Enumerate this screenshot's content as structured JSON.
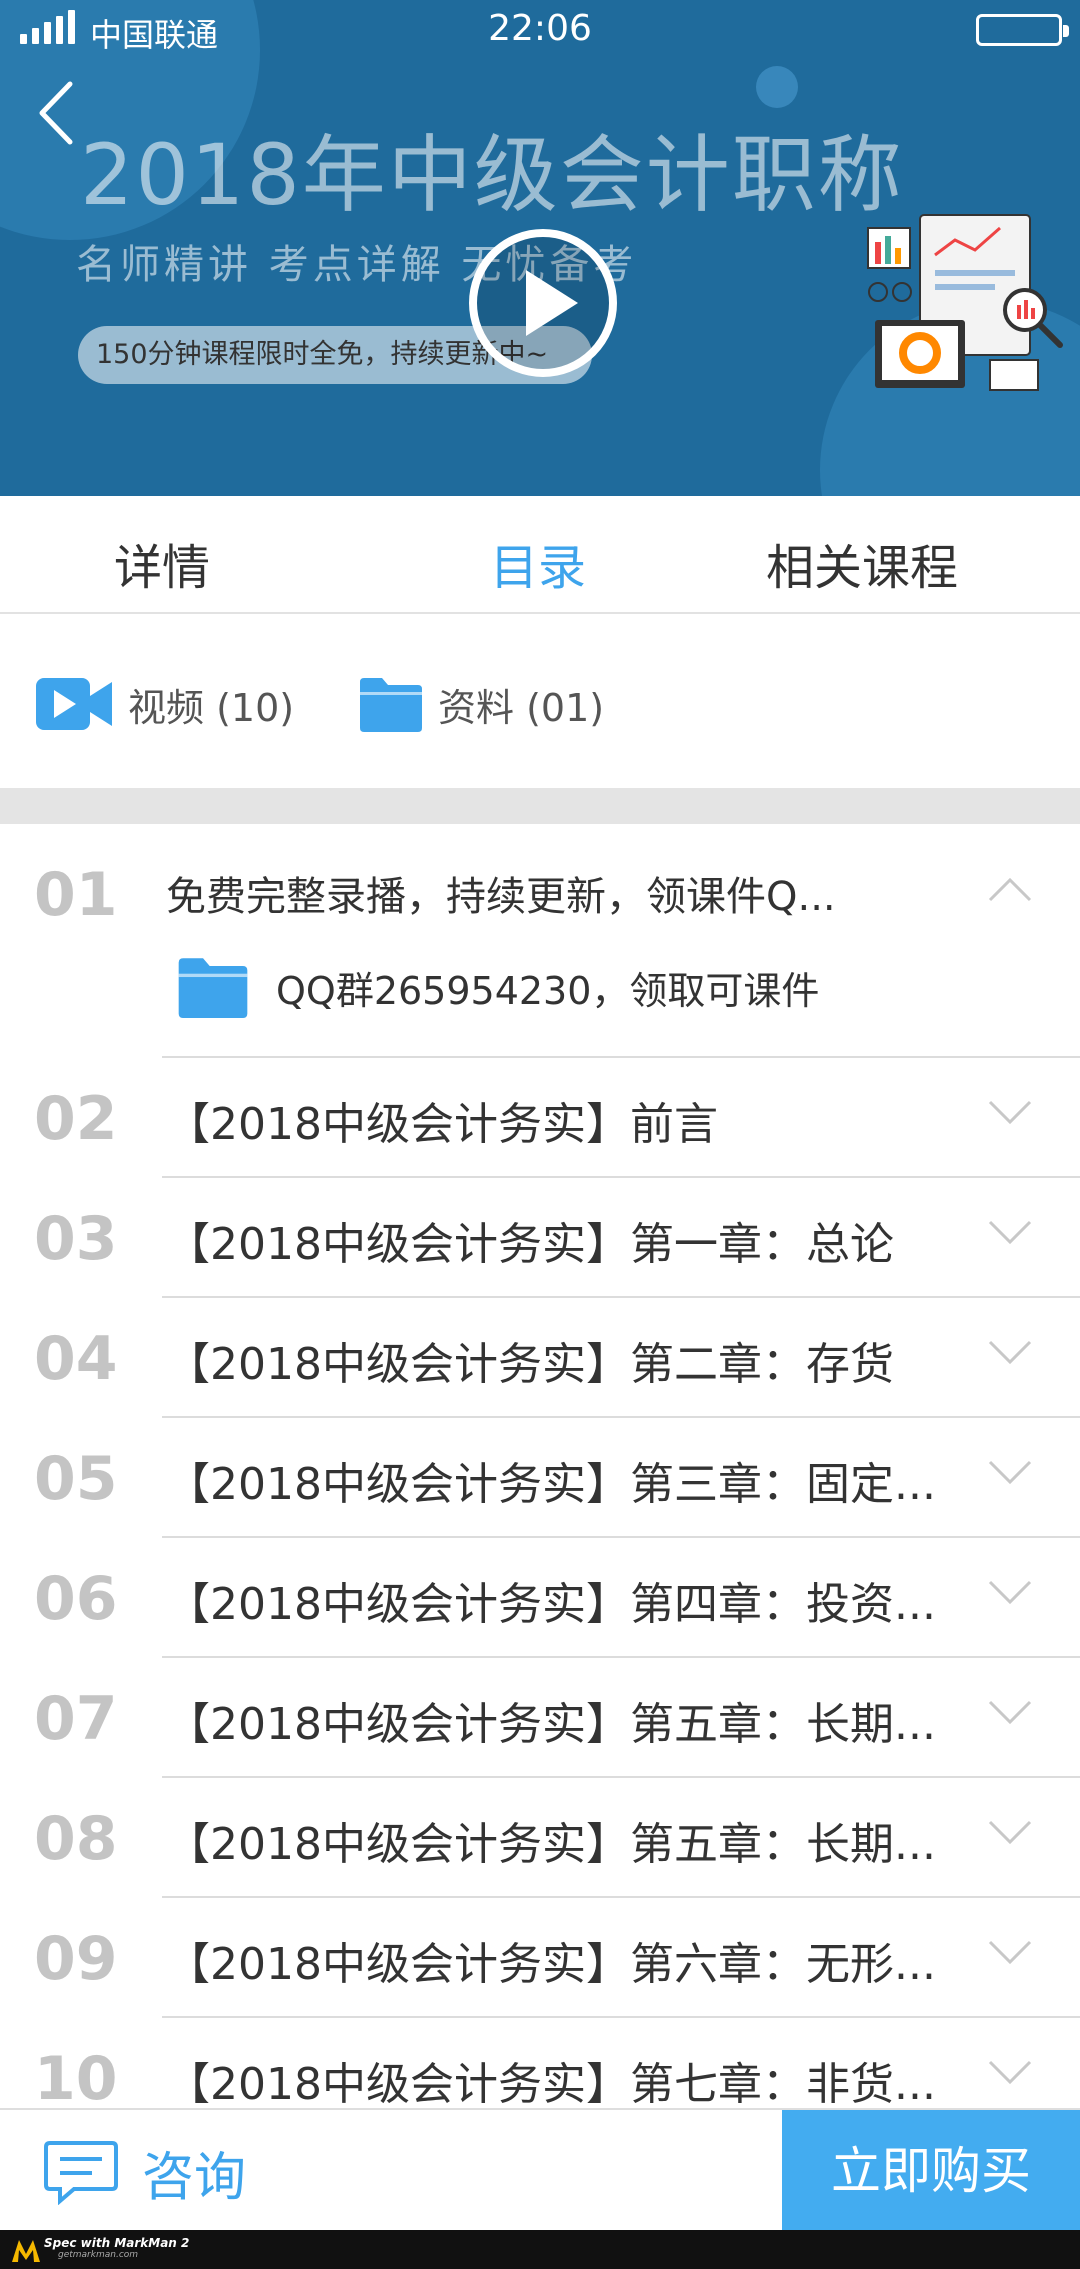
{
  "status_bar": {
    "carrier": "中国联通",
    "time": "22:06"
  },
  "banner": {
    "title": "2018年中级会计职称",
    "subtitle": "名师精讲   考点详解   无忧备考",
    "pill_text": "150分钟课程限时全免，持续更新中~"
  },
  "tabs": [
    {
      "label": "详情",
      "active": false
    },
    {
      "label": "目录",
      "active": true
    },
    {
      "label": "相关课程",
      "active": false
    }
  ],
  "filters": {
    "video": {
      "label": "视频 (10)",
      "icon": "video-camera-icon"
    },
    "material": {
      "label": "资料 (01)",
      "icon": "folder-icon"
    }
  },
  "chapters": [
    {
      "num": "01",
      "title": "免费完整录播，持续更新，领课件Q...",
      "expanded": true,
      "sub_item": {
        "label": "QQ群265954230，领取可课件",
        "icon": "folder-icon"
      }
    },
    {
      "num": "02",
      "title": "【2018中级会计务实】前言",
      "expanded": false
    },
    {
      "num": "03",
      "title": "【2018中级会计务实】第一章：总论",
      "expanded": false
    },
    {
      "num": "04",
      "title": "【2018中级会计务实】第二章：存货",
      "expanded": false
    },
    {
      "num": "05",
      "title": "【2018中级会计务实】第三章：固定...",
      "expanded": false
    },
    {
      "num": "06",
      "title": "【2018中级会计务实】第四章：投资...",
      "expanded": false
    },
    {
      "num": "07",
      "title": "【2018中级会计务实】第五章：长期...",
      "expanded": false
    },
    {
      "num": "08",
      "title": "【2018中级会计务实】第五章：长期...",
      "expanded": false
    },
    {
      "num": "09",
      "title": "【2018中级会计务实】第六章：无形...",
      "expanded": false
    },
    {
      "num": "10",
      "title": "【2018中级会计务实】第七章：非货...",
      "expanded": false
    }
  ],
  "bottom_bar": {
    "consult_label": "咨询",
    "buy_label": "立即购买"
  },
  "watermark": {
    "line1": "Spec with MarkMan 2",
    "line2": "getmarkman.com"
  },
  "colors": {
    "accent": "#3ea4ec",
    "banner_bg": "#1f6b9c",
    "buy_bg": "#43acf0",
    "number_gray": "#c4c4c4"
  }
}
